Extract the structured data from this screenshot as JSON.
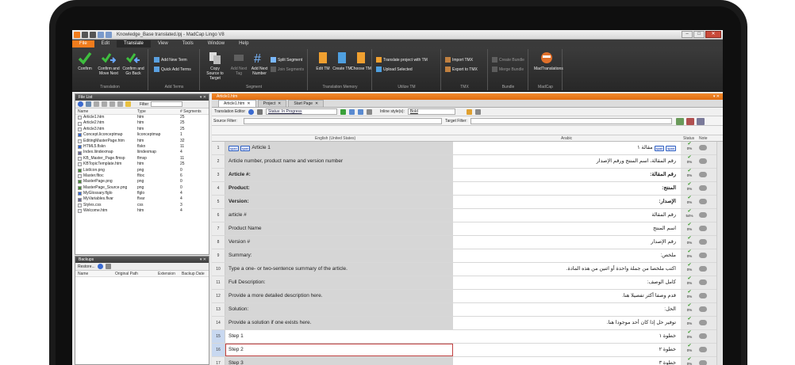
{
  "window": {
    "title": "Knowledge_Base translated.lpj - MadCap Lingo V8"
  },
  "ribbon_tabs": [
    "File",
    "Edit",
    "Translate",
    "View",
    "Tools",
    "Window",
    "Help"
  ],
  "ribbon": {
    "translation_group": {
      "label": "Translation",
      "confirm": "Confirm",
      "confirm_next": "Confirm and Move Next",
      "confirm_back": "Confirm and Go Back"
    },
    "terms_group": {
      "label": "Add Terms",
      "add_new_term": "Add New Term",
      "quick_add_terms": "Quick Add Terms"
    },
    "segment_group": {
      "label": "Segment",
      "copy_source": "Copy Source to Target",
      "add_next_tag": "Add Next Tag",
      "add_next_number": "Add Next Number",
      "split_segment": "Split Segment",
      "join_segments": "Join Segments"
    },
    "tm_group": {
      "label": "Translation Memory",
      "edit": "Edit TM",
      "create": "Create TM",
      "choose": "Choose TM"
    },
    "utilize_group": {
      "label": "Utilize TM",
      "translate_project": "Translate project with TM",
      "upload_selected": "Upload Selected"
    },
    "tmx_group": {
      "label": "TMX",
      "import": "Import TMX",
      "export": "Export to TMX"
    },
    "bundle_group": {
      "label": "Bundle",
      "create": "Create Bundle",
      "merge": "Merge Bundle"
    },
    "madcap_group": {
      "label": "MadCap",
      "madtranslations": "MadTranslations"
    }
  },
  "file_list": {
    "title": "File List",
    "filter_label": "Filter",
    "columns": [
      "Name",
      "Type",
      "# Segments"
    ],
    "rows": [
      {
        "name": "Article1.htm",
        "type": "htm",
        "segments": "25"
      },
      {
        "name": "Article2.htm",
        "type": "htm",
        "segments": "25"
      },
      {
        "name": "Article3.htm",
        "type": "htm",
        "segments": "25"
      },
      {
        "name": "Concept.liconceptmap",
        "type": "liconceptmap",
        "segments": "1"
      },
      {
        "name": "EditingMasterPage.htm",
        "type": "htm",
        "segments": "32"
      },
      {
        "name": "HTML5.flskn",
        "type": "flskn",
        "segments": "11"
      },
      {
        "name": "Index.liindexmap",
        "type": "liindexmap",
        "segments": "4"
      },
      {
        "name": "KB_Master_Page.flmsp",
        "type": "flmsp",
        "segments": "11"
      },
      {
        "name": "KBTopicTemplate.htm",
        "type": "htm",
        "segments": "25"
      },
      {
        "name": "ListIcon.png",
        "type": "png",
        "segments": "0"
      },
      {
        "name": "Master.fltoc",
        "type": "fltoc",
        "segments": "6"
      },
      {
        "name": "MasterPage.png",
        "type": "png",
        "segments": "0"
      },
      {
        "name": "MasterPage_Source.png",
        "type": "png",
        "segments": "0"
      },
      {
        "name": "MyGlossary.flglo",
        "type": "flglo",
        "segments": "4"
      },
      {
        "name": "MyVariables.flvar",
        "type": "flvar",
        "segments": "4"
      },
      {
        "name": "Styles.css",
        "type": "css",
        "segments": "3"
      },
      {
        "name": "Welcome.htm",
        "type": "htm",
        "segments": "4"
      }
    ]
  },
  "backups": {
    "title": "Backups",
    "restore_label": "Restore...",
    "columns": [
      "Name",
      "Original Path",
      "Extension",
      "Backup Date"
    ]
  },
  "editor": {
    "title": "Article1.htm",
    "tabs": [
      "Article1.htm",
      "Project",
      "Start Page"
    ],
    "toolbar_label": "Translation Editor",
    "status_filter": "Status: In Progress",
    "inline_styles_label": "Inline style(s):",
    "inline_styles_value": "Bold",
    "source_filter_label": "Source Filter:",
    "target_filter_label": "Target Filter:",
    "col_source": "English (United States)",
    "col_target": "Arabic",
    "col_status": "Status",
    "col_note": "Note",
    "segments": [
      {
        "num": "1",
        "source": "Article 1",
        "target": "مقالة ١",
        "bold": false,
        "tags": true,
        "status": "0%"
      },
      {
        "num": "2",
        "source": "Article number, product name and version number",
        "target": "رقم المقالة، اسم المنتج ورقم الإصدار",
        "bold": false,
        "tags": false,
        "status": "0%"
      },
      {
        "num": "3",
        "source": "Article #:",
        "target": "رقم المقالة:",
        "bold": true,
        "tags": false,
        "status": "0%"
      },
      {
        "num": "4",
        "source": "Product:",
        "target": "المنتج:",
        "bold": true,
        "tags": false,
        "status": "0%"
      },
      {
        "num": "5",
        "source": "Version:",
        "target": "الإصدار:",
        "bold": true,
        "tags": false,
        "status": "0%"
      },
      {
        "num": "6",
        "source": "article #",
        "target": "رقم المقالة",
        "bold": false,
        "tags": false,
        "status": "54%"
      },
      {
        "num": "7",
        "source": "Product Name",
        "target": "اسم المنتج",
        "bold": false,
        "tags": false,
        "status": "0%"
      },
      {
        "num": "8",
        "source": "Version #",
        "target": "رقم الإصدار",
        "bold": false,
        "tags": false,
        "status": "0%"
      },
      {
        "num": "9",
        "source": "Summary:",
        "target": "ملخص:",
        "bold": false,
        "tags": false,
        "status": "0%"
      },
      {
        "num": "10",
        "source": "Type a one- or two-sentence summary of the article.",
        "target": "اكتب ملخصا من جملة واحدة أو اثنين من هذه المادة.",
        "bold": false,
        "tags": false,
        "status": "0%"
      },
      {
        "num": "11",
        "source": "Full Description:",
        "target": "كامل الوصف:",
        "bold": false,
        "tags": false,
        "status": "0%"
      },
      {
        "num": "12",
        "source": "Provide a more detailed description here.",
        "target": "قدم وصفا أكثر تفصيلا هنا.",
        "bold": false,
        "tags": false,
        "status": "0%"
      },
      {
        "num": "13",
        "source": "Solution:",
        "target": "الحل:",
        "bold": false,
        "tags": false,
        "status": "0%"
      },
      {
        "num": "14",
        "source": "Provide a solution if one exists here.",
        "target": "توفير حل إذا كان أحد موجودا هنا.",
        "bold": false,
        "tags": false,
        "status": "0%"
      },
      {
        "num": "15",
        "source": "Step 1",
        "target": "خطوة ١",
        "bold": false,
        "tags": false,
        "status": "0%"
      },
      {
        "num": "16",
        "source": "Step 2",
        "target": "خطوة ٢",
        "bold": false,
        "tags": false,
        "status": "0%"
      },
      {
        "num": "17",
        "source": "Step 3",
        "target": "خطوة ٣",
        "bold": false,
        "tags": false,
        "status": "0%"
      }
    ]
  },
  "colors": {
    "accent": "#f07c1c",
    "ribbon": "#2f2f2f",
    "check": "#3a9a2a"
  }
}
